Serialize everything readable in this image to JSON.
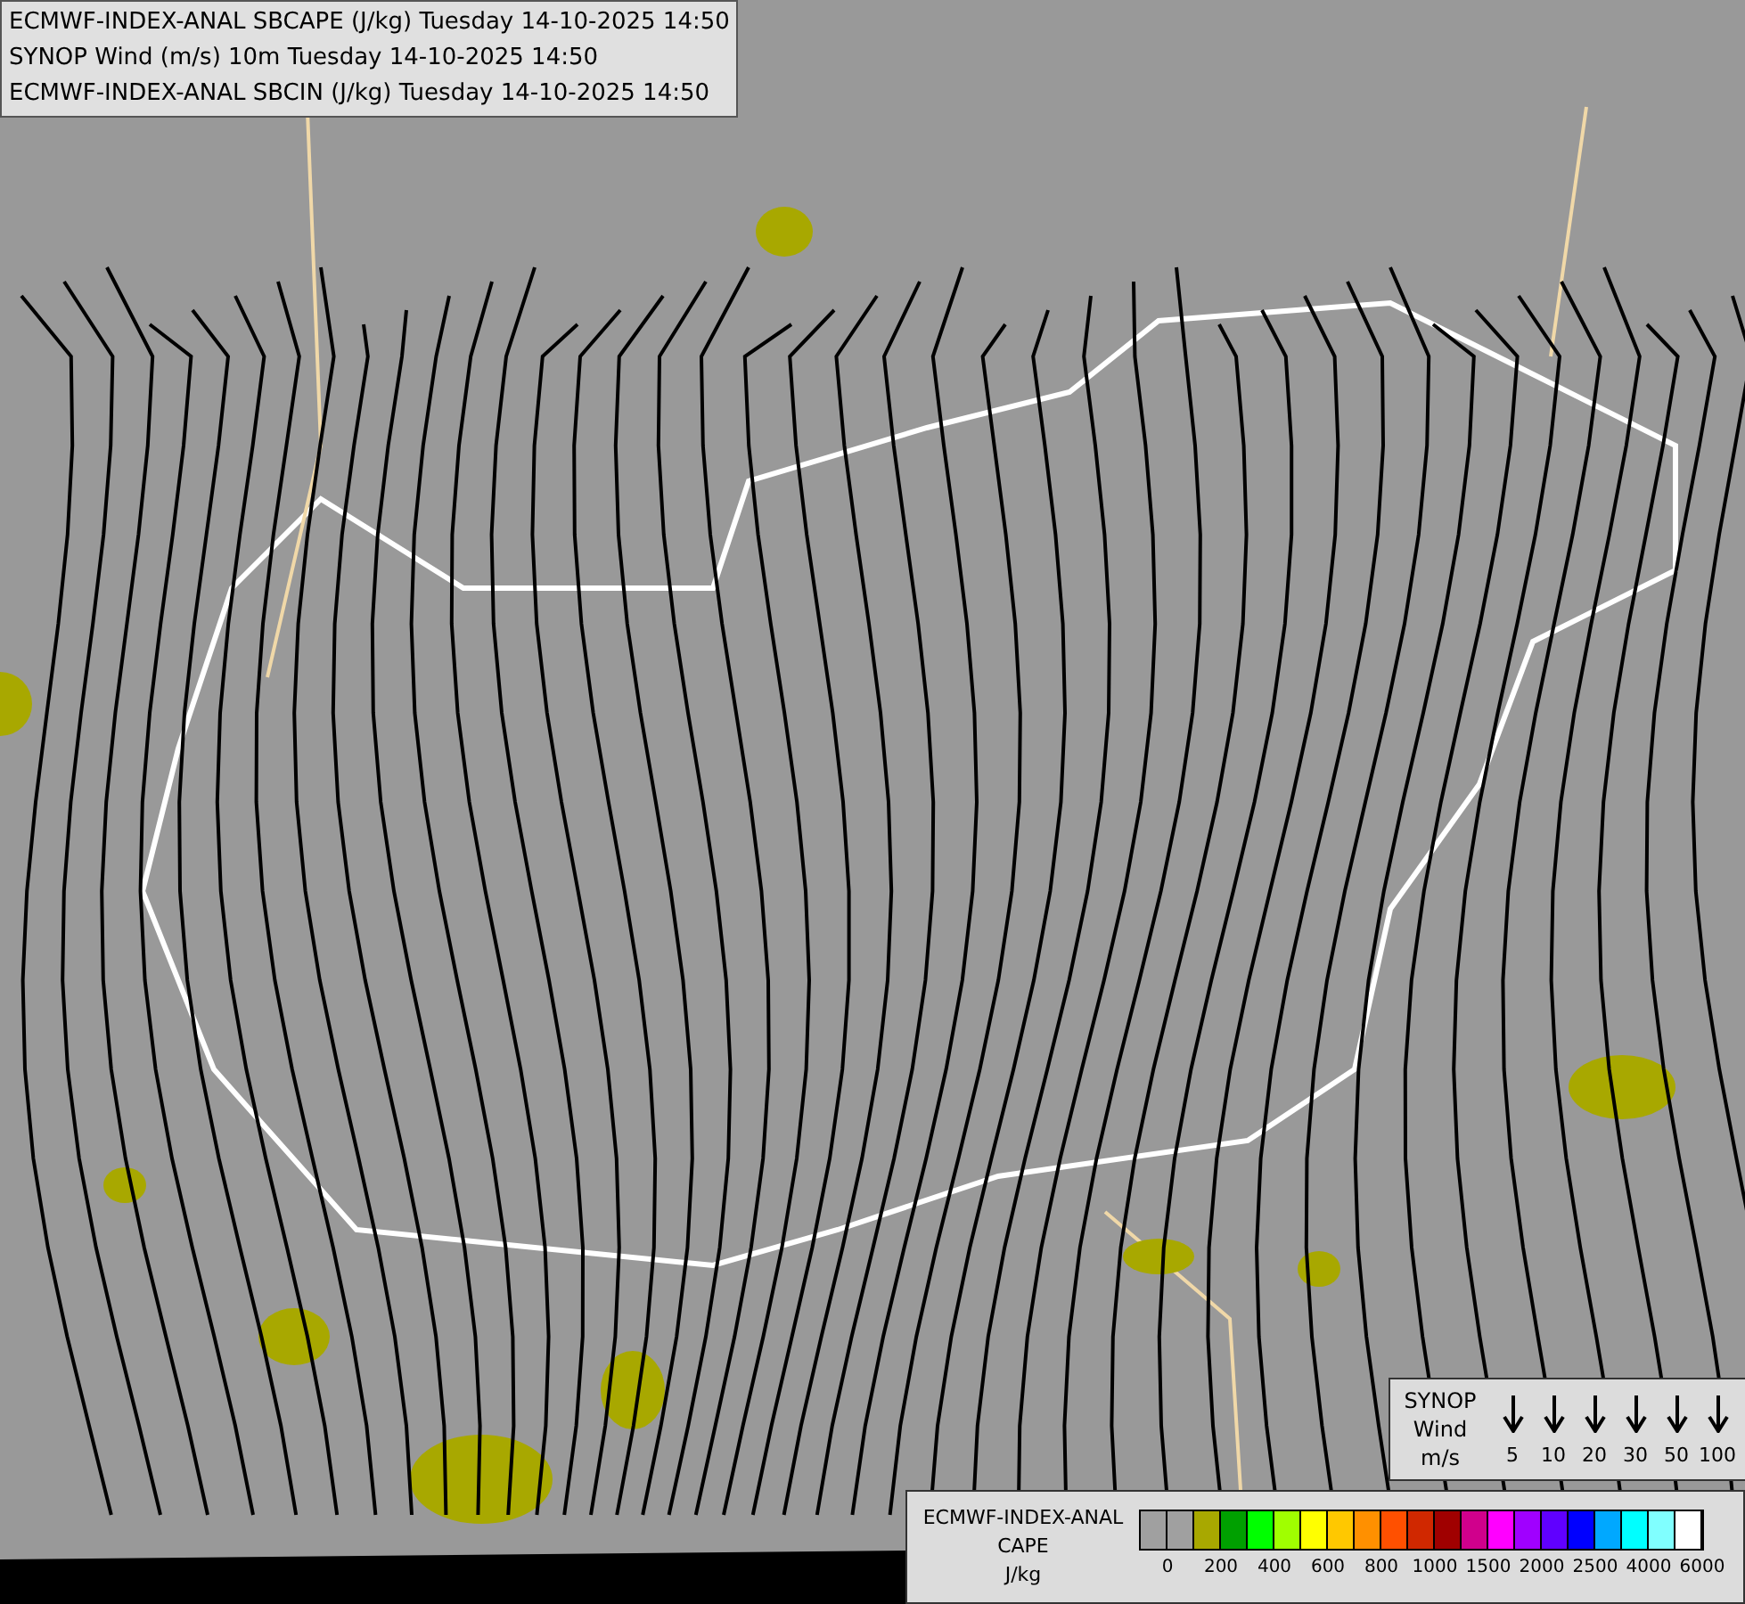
{
  "title_box": {
    "lines": [
      "ECMWF-INDEX-ANAL SBCAPE (J/kg) Tuesday 14-10-2025 14:50",
      "SYNOP Wind (m/s) 10m Tuesday 14-10-2025 14:50",
      "ECMWF-INDEX-ANAL SBCIN (J/kg) Tuesday 14-10-2025 14:50"
    ]
  },
  "wind_legend": {
    "title_lines": [
      "SYNOP",
      "Wind",
      "m/s"
    ],
    "speeds": [
      "5",
      "10",
      "20",
      "30",
      "50",
      "100"
    ]
  },
  "cape_legend": {
    "title_lines": [
      "ECMWF-INDEX-ANAL",
      "CAPE",
      "J/kg"
    ],
    "swatches": [
      {
        "color": "#a0a0a0"
      },
      {
        "color": "#a0a0a0"
      },
      {
        "color": "#a8a800"
      },
      {
        "color": "#00a000"
      },
      {
        "color": "#00ff00"
      },
      {
        "color": "#a0ff00"
      },
      {
        "color": "#ffff00"
      },
      {
        "color": "#ffc800"
      },
      {
        "color": "#ff9000"
      },
      {
        "color": "#ff5000"
      },
      {
        "color": "#d02800"
      },
      {
        "color": "#a00000"
      },
      {
        "color": "#d0008c"
      },
      {
        "color": "#ff00ff"
      },
      {
        "color": "#a000ff"
      },
      {
        "color": "#6000ff"
      },
      {
        "color": "#0000ff"
      },
      {
        "color": "#00a8ff"
      },
      {
        "color": "#00ffff"
      },
      {
        "color": "#80ffff"
      },
      {
        "color": "#ffffff"
      }
    ],
    "labels": [
      "0",
      "200",
      "400",
      "600",
      "800",
      "1000",
      "1500",
      "2000",
      "2500",
      "4000",
      "6000"
    ]
  }
}
